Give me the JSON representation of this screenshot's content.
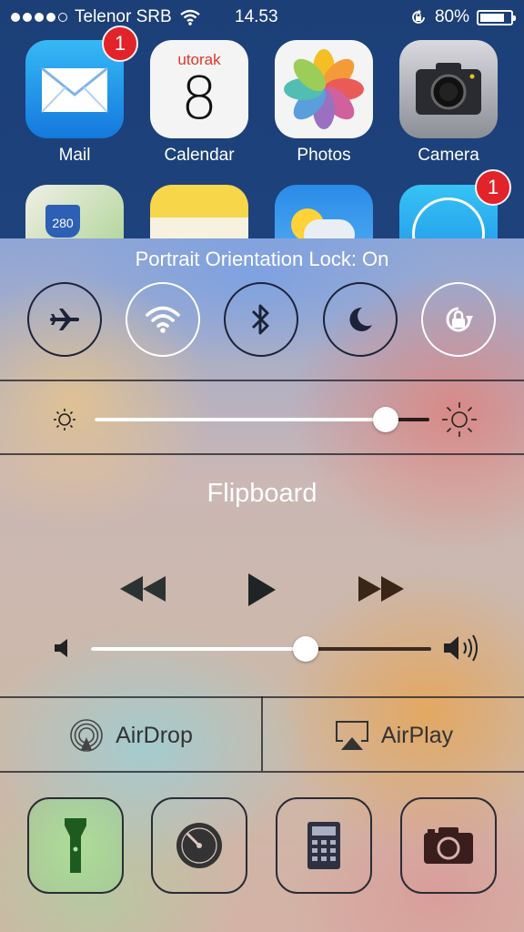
{
  "status_bar": {
    "carrier": "Telenor SRB",
    "signal_bars_filled": 4,
    "signal_bars_total": 5,
    "wifi_icon": "wifi-icon",
    "time": "14.53",
    "rotation_lock_icon": "rotation-lock-icon",
    "battery_percent_text": "80%",
    "battery_level": 0.8
  },
  "home_screen": {
    "apps": [
      {
        "label": "Mail",
        "badge": "1",
        "icon": "mail-icon"
      },
      {
        "label": "Calendar",
        "day_name": "utorak",
        "day_number": "8",
        "icon": "calendar-icon"
      },
      {
        "label": "Photos",
        "icon": "photos-icon"
      },
      {
        "label": "Camera",
        "icon": "camera-icon"
      }
    ],
    "row2_badge": "1",
    "maps_shield_text": "280"
  },
  "control_center": {
    "title": "Portrait Orientation Lock: On",
    "toggles": [
      {
        "name": "airplane-mode",
        "icon": "airplane-icon",
        "on": false
      },
      {
        "name": "wifi",
        "icon": "wifi-icon",
        "on": true
      },
      {
        "name": "bluetooth",
        "icon": "bluetooth-icon",
        "on": false
      },
      {
        "name": "do-not-disturb",
        "icon": "moon-icon",
        "on": false
      },
      {
        "name": "orientation-lock",
        "icon": "rotation-lock-icon",
        "on": true
      }
    ],
    "brightness": 0.87,
    "now_playing": "Flipboard",
    "volume": 0.63,
    "airdrop_label": "AirDrop",
    "airplay_label": "AirPlay",
    "shortcuts": [
      {
        "name": "flashlight",
        "icon": "flashlight-icon",
        "active": true
      },
      {
        "name": "timer",
        "icon": "timer-icon",
        "active": false
      },
      {
        "name": "calculator",
        "icon": "calculator-icon",
        "active": false
      },
      {
        "name": "camera",
        "icon": "camera-icon",
        "active": false
      }
    ],
    "colors": {
      "active_toggle": "#ffffff",
      "inactive_toggle": "#1c2238",
      "flashlight_active": "#2e6a2e"
    }
  }
}
